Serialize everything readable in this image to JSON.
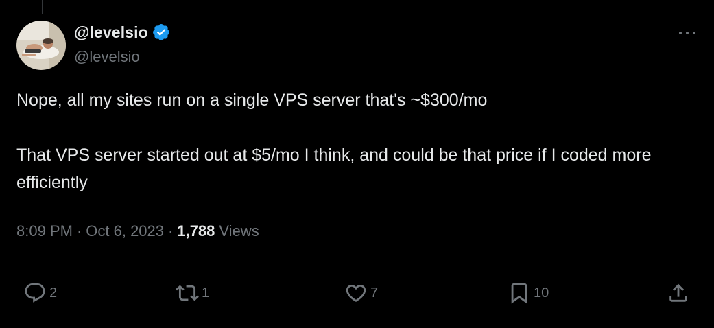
{
  "author": {
    "display_name": "@levelsio",
    "handle": "@levelsio",
    "verified": true
  },
  "tweet": {
    "paragraphs": [
      "Nope, all my sites run on a single VPS server that's ~$300/mo",
      "That VPS server started out at $5/mo I think, and could be that price if I coded more efficiently"
    ],
    "time": "8:09 PM",
    "separator": "·",
    "date": "Oct 6, 2023",
    "views_count": "1,788",
    "views_label": "Views"
  },
  "actions": {
    "replies": "2",
    "retweets": "1",
    "likes": "7",
    "bookmarks": "10"
  },
  "icons": {
    "reply": "reply-icon",
    "retweet": "retweet-icon",
    "like": "heart-icon",
    "bookmark": "bookmark-icon",
    "share": "share-icon",
    "more": "more-icon",
    "verified": "verified-badge-icon"
  },
  "colors": {
    "background": "#000000",
    "text_primary": "#e7e9ea",
    "text_secondary": "#71767b",
    "verified_blue": "#1d9bf0",
    "divider": "#2f3336"
  }
}
